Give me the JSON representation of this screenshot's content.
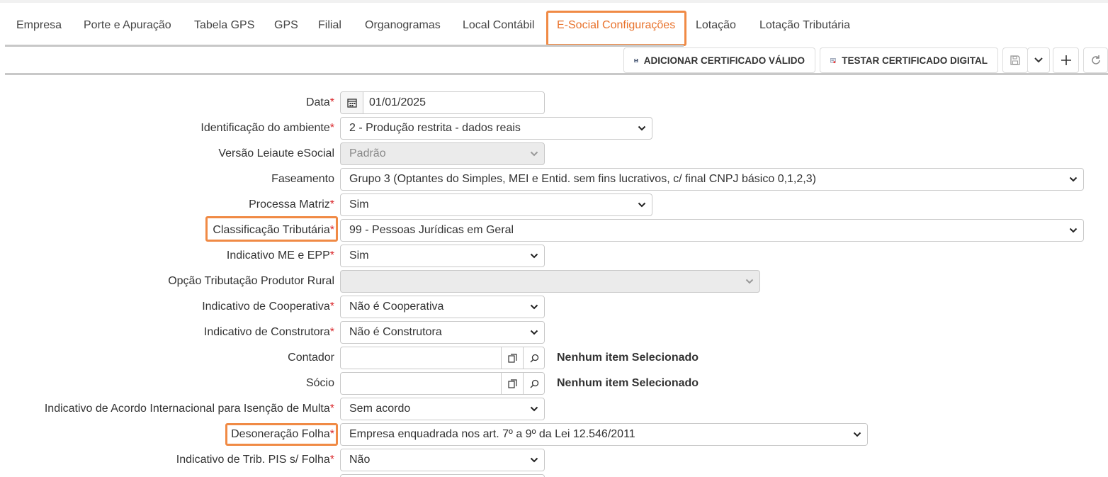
{
  "tabs": [
    {
      "label": "Empresa",
      "active": false
    },
    {
      "label": "Porte e Apuração",
      "active": false
    },
    {
      "label": "Tabela GPS",
      "active": false
    },
    {
      "label": "GPS",
      "active": false
    },
    {
      "label": "Filial",
      "active": false
    },
    {
      "label": "Organogramas",
      "active": false
    },
    {
      "label": "Local Contábil",
      "active": false
    },
    {
      "label": "E-Social Configurações",
      "active": true
    },
    {
      "label": "Lotação",
      "active": false
    },
    {
      "label": "Lotação Tributária",
      "active": false
    }
  ],
  "toolbar": {
    "add_certificate": "ADICIONAR CERTIFICADO VÁLIDO",
    "test_certificate": "TESTAR CERTIFICADO DIGITAL",
    "icons": [
      "save-icon",
      "chevron-down-icon",
      "plus-icon",
      "refresh-icon"
    ]
  },
  "form": {
    "data": {
      "label": "Data",
      "value": "01/01/2025"
    },
    "ambiente": {
      "label": "Identificação do ambiente",
      "value": "2 - Produção restrita - dados reais"
    },
    "versao": {
      "label": "Versão Leiaute eSocial",
      "value": "Padrão"
    },
    "faseamento": {
      "label": "Faseamento",
      "value": "Grupo 3 (Optantes do Simples, MEI e Entid. sem fins lucrativos, c/ final CNPJ básico 0,1,2,3)"
    },
    "processa_matriz": {
      "label": "Processa Matriz",
      "value": "Sim"
    },
    "classificacao": {
      "label": "Classificação Tributária",
      "value": "99 - Pessoas Jurídicas em Geral"
    },
    "me_epp": {
      "label": "Indicativo ME e EPP",
      "value": "Sim"
    },
    "produtor_rural": {
      "label": "Opção Tributação Produtor Rural",
      "value": ""
    },
    "cooperativa": {
      "label": "Indicativo de Cooperativa",
      "value": "Não é Cooperativa"
    },
    "construtora": {
      "label": "Indicativo de Construtora",
      "value": "Não é Construtora"
    },
    "contador": {
      "label": "Contador",
      "value": "",
      "info": "Nenhum item Selecionado"
    },
    "socio": {
      "label": "Sócio",
      "value": "",
      "info": "Nenhum item Selecionado"
    },
    "acordo": {
      "label": "Indicativo de Acordo Internacional para Isenção de Multa",
      "value": "Sem acordo"
    },
    "desoneracao": {
      "label": "Desoneração Folha",
      "value": "Empresa enquadrada nos art. 7º a 9º da Lei 12.546/2011"
    },
    "pis": {
      "label": "Indicativo de Trib. PIS s/ Folha",
      "value": "Não"
    }
  },
  "required_mark": "*"
}
